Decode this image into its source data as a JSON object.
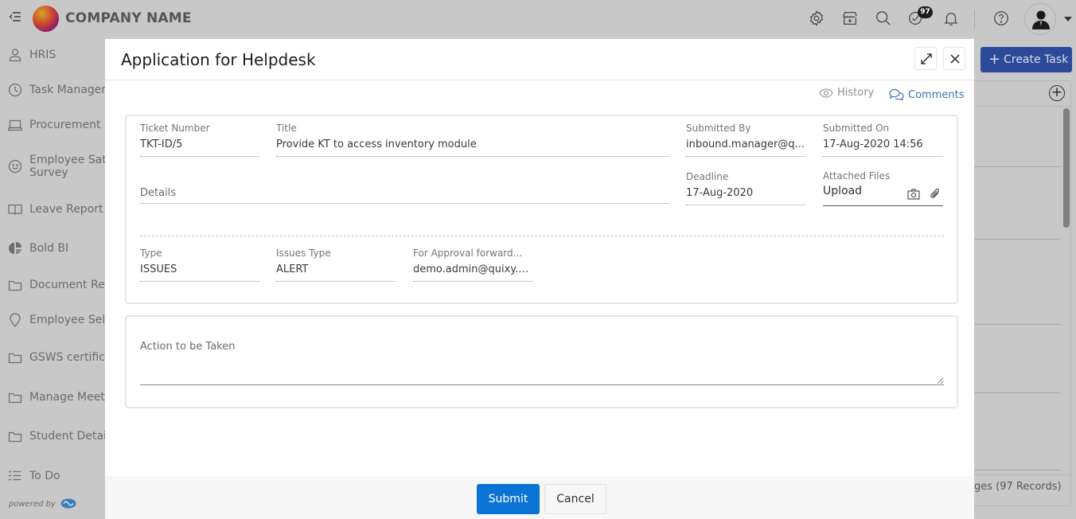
{
  "header": {
    "brand": "COMPANY NAME",
    "notification_count": "97",
    "icons": [
      "menu-toggle-icon",
      "settings-icon",
      "store-icon",
      "search-icon",
      "tasks-check-icon",
      "bell-icon",
      "help-icon",
      "user-avatar-icon"
    ]
  },
  "sidebar": {
    "items": [
      {
        "label": "HRIS",
        "icon": "user-icon"
      },
      {
        "label": "Task Management",
        "icon": "clock-icon"
      },
      {
        "label": "Procurement",
        "icon": "laptop-icon"
      },
      {
        "label": "Employee Satisfaction",
        "label2": "Survey",
        "icon": "smiley-icon"
      },
      {
        "label": "Leave Report",
        "icon": "book-icon"
      },
      {
        "label": "Bold BI",
        "icon": "pie-chart-icon"
      },
      {
        "label": "Document Repository",
        "icon": "folder-icon"
      },
      {
        "label": "Employee Self Service",
        "icon": "location-pin-icon"
      },
      {
        "label": "GSWS certificates",
        "icon": "folder-icon"
      },
      {
        "label": "Manage Meetings",
        "icon": "folder-icon"
      },
      {
        "label": "Student Details",
        "icon": "folder-icon"
      },
      {
        "label": "To Do",
        "icon": "checklist-icon"
      }
    ],
    "powered_by": "powered by"
  },
  "background": {
    "create_task_label": "Create Task",
    "records_text": "ages (97 Records)"
  },
  "modal": {
    "title": "Application for Helpdesk",
    "history_label": "History",
    "comments_label": "Comments",
    "fields": {
      "ticket_number": {
        "label": "Ticket Number",
        "value": "TKT-ID/5"
      },
      "title": {
        "label": "Title",
        "value": "Provide KT to access inventory module"
      },
      "submitted_by": {
        "label": "Submitted By",
        "value": "inbound.manager@q..."
      },
      "submitted_on": {
        "label": "Submitted On",
        "value": "17-Aug-2020 14:56"
      },
      "details": {
        "label": "Details",
        "value": ""
      },
      "deadline": {
        "label": "Deadline",
        "value": "17-Aug-2020"
      },
      "attached_files": {
        "label": "Attached Files",
        "value": "Upload"
      },
      "type": {
        "label": "Type",
        "value": "ISSUES"
      },
      "issues_type": {
        "label": "Issues Type",
        "value": "ALERT"
      },
      "approval_forward": {
        "label": "For Approval forward...",
        "value": "demo.admin@quixy.c..."
      }
    },
    "action": {
      "label": "Action to be Taken",
      "value": ""
    },
    "submit_label": "Submit",
    "cancel_label": "Cancel"
  }
}
